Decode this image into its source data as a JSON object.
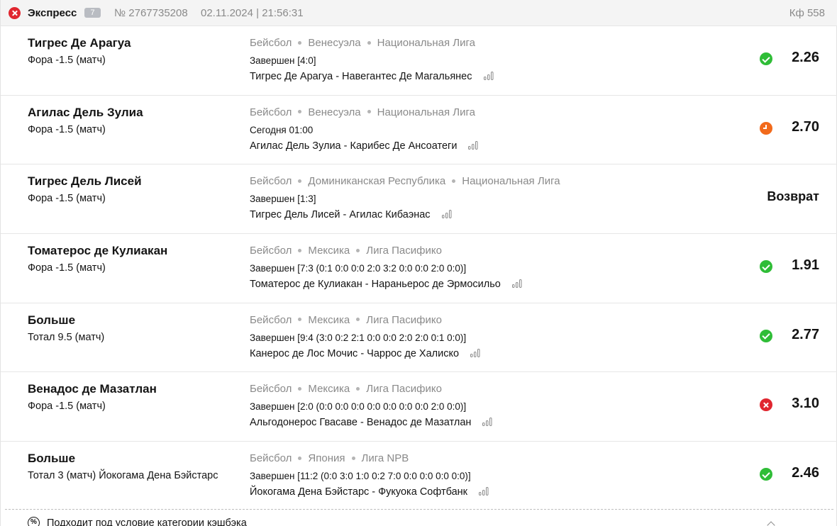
{
  "header": {
    "bet_type": "Экспресс",
    "selections_count": "7",
    "bet_number": "№ 2767735208",
    "datetime": "02.11.2024 | 21:56:31",
    "total_coef": "Кф 558"
  },
  "selections": [
    {
      "outcome": "Тигрес Де Арагуа",
      "market": "Фора -1.5 (матч)",
      "sport": "Бейсбол",
      "country": "Венесуэла",
      "league": "Национальная Лига",
      "state": "Завершен [4:0]",
      "match": "Тигрес Де Арагуа - Навегантес Де Магальянес",
      "result": "win",
      "odds": "2.26"
    },
    {
      "outcome": "Агилас Дель Зулиа",
      "market": "Фора -1.5 (матч)",
      "sport": "Бейсбол",
      "country": "Венесуэла",
      "league": "Национальная Лига",
      "state": "Сегодня 01:00",
      "match": "Агилас Дель Зулиа - Карибес Де Ансоатеги",
      "result": "pending",
      "odds": "2.70"
    },
    {
      "outcome": "Тигрес Дель Лисей",
      "market": "Фора -1.5 (матч)",
      "sport": "Бейсбол",
      "country": "Доминиканская Республика",
      "league": "Национальная Лига",
      "state": "Завершен [1:3]",
      "match": "Тигрес Дель Лисей - Агилас Кибаэнас",
      "result": "refund",
      "odds": "Возврат"
    },
    {
      "outcome": "Томатерос де Кулиакан",
      "market": "Фора -1.5 (матч)",
      "sport": "Бейсбол",
      "country": "Мексика",
      "league": "Лига Пасифико",
      "state": "Завершен [7:3 (0:1 0:0 0:0 2:0 3:2 0:0 0:0 2:0 0:0)]",
      "match": "Томатерос де Кулиакан - Нараньерос де Эрмосильо",
      "result": "win",
      "odds": "1.91"
    },
    {
      "outcome": "Больше",
      "market": "Тотал 9.5 (матч)",
      "sport": "Бейсбол",
      "country": "Мексика",
      "league": "Лига Пасифико",
      "state": "Завершен [9:4 (3:0 0:2 2:1 0:0 0:0 2:0 2:0 0:1 0:0)]",
      "match": "Канерос де Лос Мочис - Чаррос де Халиско",
      "result": "win",
      "odds": "2.77"
    },
    {
      "outcome": "Венадос де Мазатлан",
      "market": "Фора -1.5 (матч)",
      "sport": "Бейсбол",
      "country": "Мексика",
      "league": "Лига Пасифико",
      "state": "Завершен [2:0 (0:0 0:0 0:0 0:0 0:0 0:0 0:0 2:0 0:0)]",
      "match": "Альгодонерос Гвасаве - Венадос де Мазатлан",
      "result": "lose",
      "odds": "3.10"
    },
    {
      "outcome": "Больше",
      "market": "Тотал 3 (матч) Йокогама Дена Бэйстарс",
      "sport": "Бейсбол",
      "country": "Япония",
      "league": "Лига NPB",
      "state": "Завершен [11:2 (0:0 3:0 1:0 0:2 7:0 0:0 0:0 0:0 0:0)]",
      "match": "Йокогама Дена Бэйстарс - Фукуока Софтбанк",
      "result": "win",
      "odds": "2.46"
    }
  ],
  "footer": {
    "cashback_icon": "%",
    "cashback_text": "Подходит под условие категории кэшбэка"
  },
  "colors": {
    "win": "#2fbd37",
    "lose": "#e0262f",
    "pending": "#f26a1b",
    "muted_text": "#8a8a8a",
    "header_bg": "#f4f4f4"
  },
  "icons": {
    "result_win": "check-circle-icon",
    "result_lose": "cross-circle-icon",
    "result_pending": "clock-icon",
    "stats": "bar-chart-icon",
    "bet_status": "cross-circle-icon"
  }
}
